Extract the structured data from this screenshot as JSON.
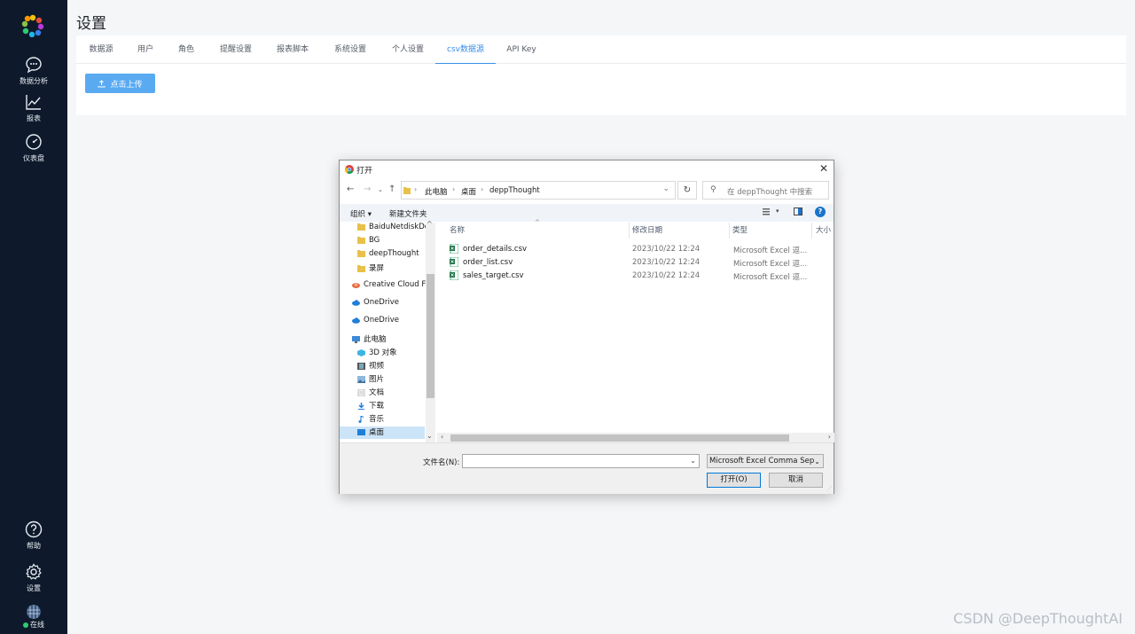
{
  "sidebar": {
    "items": [
      {
        "label": "数据分析",
        "icon": "chat-bubble-icon"
      },
      {
        "label": "报表",
        "icon": "line-chart-icon"
      },
      {
        "label": "仪表盘",
        "icon": "gauge-icon"
      }
    ],
    "bottom": [
      {
        "label": "帮助",
        "icon": "help-icon"
      },
      {
        "label": "设置",
        "icon": "gear-icon"
      }
    ],
    "status_label": "在线",
    "status_color": "#2ecc71",
    "bg_color": "#0e1a2b"
  },
  "page": {
    "title": "设置"
  },
  "tabs": [
    {
      "label": "数据源",
      "active": false
    },
    {
      "label": "用户",
      "active": false
    },
    {
      "label": "角色",
      "active": false
    },
    {
      "label": "提醒设置",
      "active": false
    },
    {
      "label": "报表脚本",
      "active": false
    },
    {
      "label": "系统设置",
      "active": false
    },
    {
      "label": "个人设置",
      "active": false
    },
    {
      "label": "csv数据源",
      "active": true
    },
    {
      "label": "API Key",
      "active": false
    }
  ],
  "upload_button": {
    "label": "点击上传",
    "color": "#5aaaf2"
  },
  "watermark": "CSDN @DeepThoughtAI",
  "dialog": {
    "title": "打开",
    "breadcrumb": [
      "此电脑",
      "桌面",
      "deppThought"
    ],
    "search_placeholder": "在 deppThought 中搜索",
    "toolbar": {
      "organize": "组织 ▾",
      "new_folder": "新建文件夹"
    },
    "nav_tree": [
      {
        "label": "BaiduNetdiskDo",
        "icon": "folder-icon"
      },
      {
        "label": "BG",
        "icon": "folder-icon"
      },
      {
        "label": "deepThought",
        "icon": "folder-icon"
      },
      {
        "label": "录屏",
        "icon": "folder-icon"
      },
      {
        "label": "Creative Cloud Fi",
        "icon": "creative-cloud-icon"
      },
      {
        "label": "OneDrive",
        "icon": "onedrive-icon"
      },
      {
        "label": "OneDrive",
        "icon": "onedrive-icon"
      },
      {
        "label": "此电脑",
        "icon": "computer-icon"
      },
      {
        "label": "3D 对象",
        "icon": "cube-icon"
      },
      {
        "label": "视频",
        "icon": "video-icon"
      },
      {
        "label": "图片",
        "icon": "picture-icon"
      },
      {
        "label": "文档",
        "icon": "document-icon"
      },
      {
        "label": "下载",
        "icon": "download-icon"
      },
      {
        "label": "音乐",
        "icon": "music-icon"
      },
      {
        "label": "桌面",
        "icon": "desktop-icon",
        "selected": true
      }
    ],
    "columns": {
      "name": "名称",
      "date": "修改日期",
      "type": "类型",
      "size": "大小"
    },
    "files": [
      {
        "name": "order_details.csv",
        "date": "2023/10/22 12:24",
        "type": "Microsoft Excel 逗..."
      },
      {
        "name": "order_list.csv",
        "date": "2023/10/22 12:24",
        "type": "Microsoft Excel 逗..."
      },
      {
        "name": "sales_target.csv",
        "date": "2023/10/22 12:24",
        "type": "Microsoft Excel 逗..."
      }
    ],
    "filename_label": "文件名(N):",
    "filename_value": "",
    "filetype": "Microsoft Excel Comma Sep",
    "open_button": "打开(O)",
    "cancel_button": "取消"
  }
}
